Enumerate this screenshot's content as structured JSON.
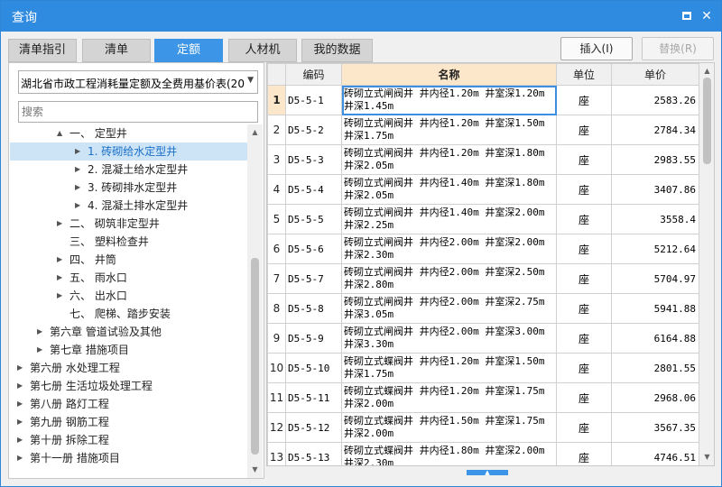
{
  "window": {
    "title": "查询",
    "maximize_icon": "maximize-icon",
    "close_icon": "close-icon",
    "close_glyph": "✕"
  },
  "tabs": [
    {
      "label": "清单指引",
      "active": false
    },
    {
      "label": "清单",
      "active": false
    },
    {
      "label": "定额",
      "active": true
    },
    {
      "label": "人材机",
      "active": false
    },
    {
      "label": "我的数据",
      "active": false
    }
  ],
  "toolbar": {
    "insert_label": "插入(I)",
    "replace_label": "替换(R)"
  },
  "left": {
    "library_select": "湖北省市政工程消耗量定额及全费用基价表(20",
    "search_placeholder": "搜索",
    "tree": [
      {
        "label": "一、 定型井",
        "arrow": "▲",
        "expanded": true
      },
      {
        "label": "1. 砖砌给水定型井",
        "arrow": "▶",
        "selected": true
      },
      {
        "label": "2. 混凝土给水定型井",
        "arrow": "▶"
      },
      {
        "label": "3. 砖砌排水定型井",
        "arrow": "▶"
      },
      {
        "label": "4. 混凝土排水定型井",
        "arrow": "▶"
      },
      {
        "label": "二、 砌筑非定型井",
        "arrow": "▶"
      },
      {
        "label": "三、 塑料检查井",
        "arrow": ""
      },
      {
        "label": "四、 井筒",
        "arrow": "▶"
      },
      {
        "label": "五、 雨水口",
        "arrow": "▶"
      },
      {
        "label": "六、 出水口",
        "arrow": "▶"
      },
      {
        "label": "七、 爬梯、踏步安装",
        "arrow": ""
      },
      {
        "label": "第六章 管道试验及其他",
        "arrow": "▶"
      },
      {
        "label": "第七章 措施项目",
        "arrow": "▶"
      },
      {
        "label": "第六册 水处理工程",
        "arrow": "▶"
      },
      {
        "label": "第七册 生活垃圾处理工程",
        "arrow": "▶"
      },
      {
        "label": "第八册 路灯工程",
        "arrow": "▶"
      },
      {
        "label": "第九册 钢筋工程",
        "arrow": "▶"
      },
      {
        "label": "第十册 拆除工程",
        "arrow": "▶"
      },
      {
        "label": "第十一册 措施项目",
        "arrow": "▶"
      }
    ]
  },
  "table": {
    "columns": [
      "",
      "编码",
      "名称",
      "单位",
      "单价"
    ],
    "rows": [
      {
        "no": "1",
        "code": "D5-5-1",
        "name": "砖砌立式闸阀井 井内径1.20m 井室深1.20m 井深1.45m",
        "unit": "座",
        "price": "2583.26"
      },
      {
        "no": "2",
        "code": "D5-5-2",
        "name": "砖砌立式闸阀井 井内径1.20m 井室深1.50m 井深1.75m",
        "unit": "座",
        "price": "2784.34"
      },
      {
        "no": "3",
        "code": "D5-5-3",
        "name": "砖砌立式闸阀井 井内径1.20m 井室深1.80m 井深2.05m",
        "unit": "座",
        "price": "2983.55"
      },
      {
        "no": "4",
        "code": "D5-5-4",
        "name": "砖砌立式闸阀井 井内径1.40m 井室深1.80m 井深2.05m",
        "unit": "座",
        "price": "3407.86"
      },
      {
        "no": "5",
        "code": "D5-5-5",
        "name": "砖砌立式闸阀井 井内径1.40m 井室深2.00m 井深2.25m",
        "unit": "座",
        "price": "3558.4"
      },
      {
        "no": "6",
        "code": "D5-5-6",
        "name": "砖砌立式闸阀井 井内径2.00m 井室深2.00m 井深2.30m",
        "unit": "座",
        "price": "5212.64"
      },
      {
        "no": "7",
        "code": "D5-5-7",
        "name": "砖砌立式闸阀井 井内径2.00m 井室深2.50m 井深2.80m",
        "unit": "座",
        "price": "5704.97"
      },
      {
        "no": "8",
        "code": "D5-5-8",
        "name": "砖砌立式闸阀井 井内径2.00m 井室深2.75m 井深3.05m",
        "unit": "座",
        "price": "5941.88"
      },
      {
        "no": "9",
        "code": "D5-5-9",
        "name": "砖砌立式闸阀井 井内径2.00m 井室深3.00m 井深3.30m",
        "unit": "座",
        "price": "6164.88"
      },
      {
        "no": "10",
        "code": "D5-5-10",
        "name": "砖砌立式蝶阀井 井内径1.20m 井室深1.50m 井深1.75m",
        "unit": "座",
        "price": "2801.55"
      },
      {
        "no": "11",
        "code": "D5-5-11",
        "name": "砖砌立式蝶阀井 井内径1.20m 井室深1.75m 井深2.00m",
        "unit": "座",
        "price": "2968.06"
      },
      {
        "no": "12",
        "code": "D5-5-12",
        "name": "砖砌立式蝶阀井 井内径1.50m 井室深1.75m 井深2.00m",
        "unit": "座",
        "price": "3567.35"
      },
      {
        "no": "13",
        "code": "D5-5-13",
        "name": "砖砌立式蝶阀井 井内径1.80m 井室深2.00m 井深2.30m",
        "unit": "座",
        "price": "4746.51"
      }
    ]
  },
  "colors": {
    "title_bar": "#2f8be0",
    "active_tab": "#3c95e6",
    "header_highlight": "#fde7ca",
    "selection": "#cde4f7"
  }
}
